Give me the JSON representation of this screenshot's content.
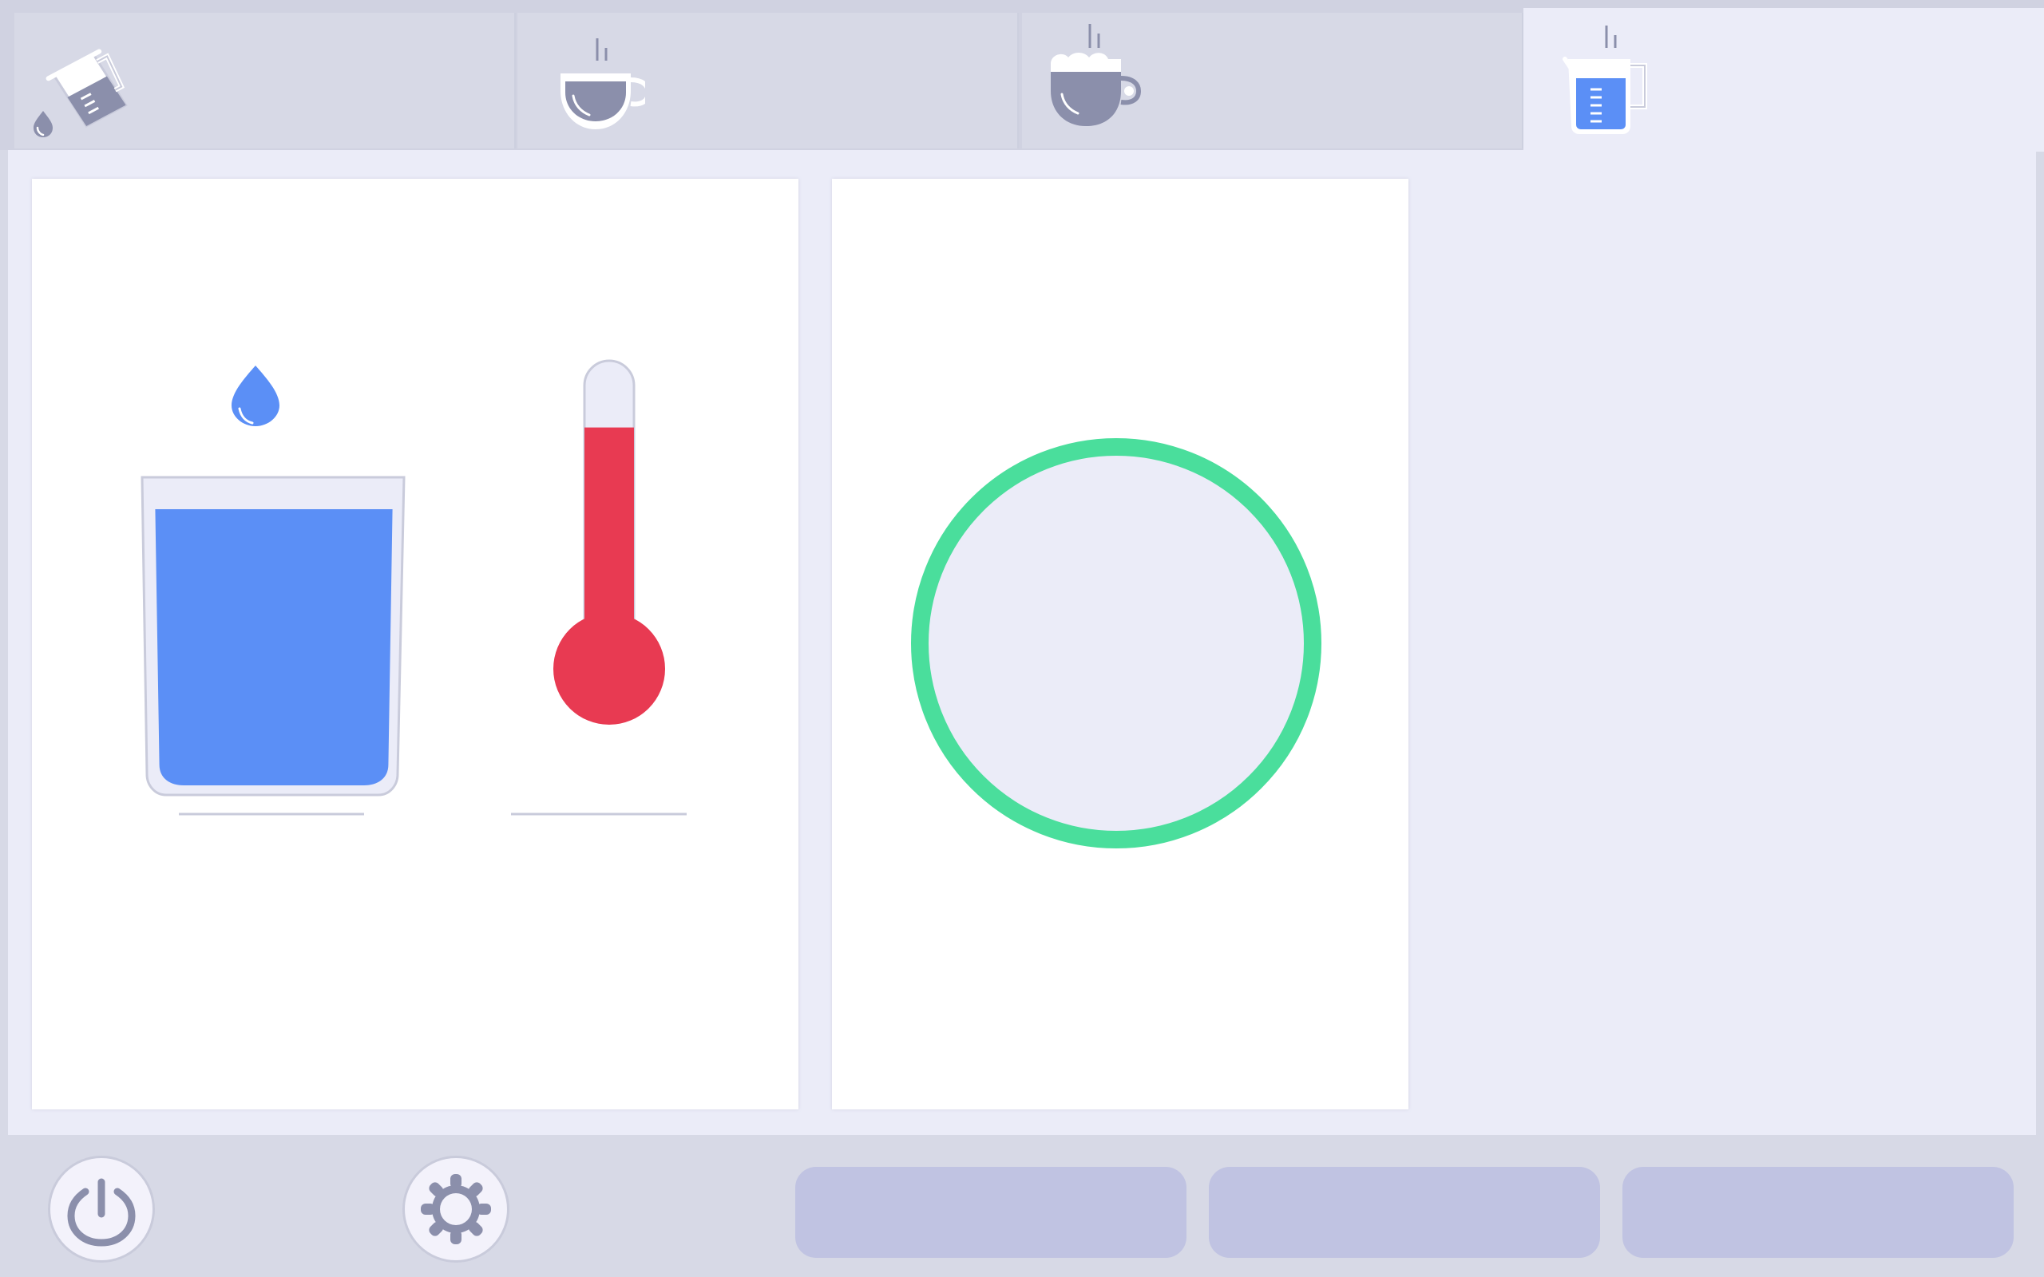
{
  "tabs": [
    {
      "id": "pour-water",
      "icon": "pouring-jug-icon",
      "active": false
    },
    {
      "id": "cup",
      "icon": "coffee-cup-icon",
      "active": false
    },
    {
      "id": "cappuccino",
      "icon": "cappuccino-cup-icon",
      "active": false
    },
    {
      "id": "kettle",
      "icon": "measuring-jug-icon",
      "active": true
    }
  ],
  "panel": {
    "water_level": 0.93,
    "water_label": "",
    "temperature_level": 0.78,
    "temperature_label": "",
    "dial_label": ""
  },
  "bottom_bar": {
    "power_icon": "power-icon",
    "settings_icon": "gear-icon",
    "buttons": [
      "",
      "",
      ""
    ]
  },
  "colors": {
    "background": "#ebecf8",
    "water": "#5b8ff6",
    "thermometer": "#e83a52",
    "dial_ring": "#4ade9c",
    "button": "#c0c3e2",
    "icon_gray": "#8b8fab"
  }
}
